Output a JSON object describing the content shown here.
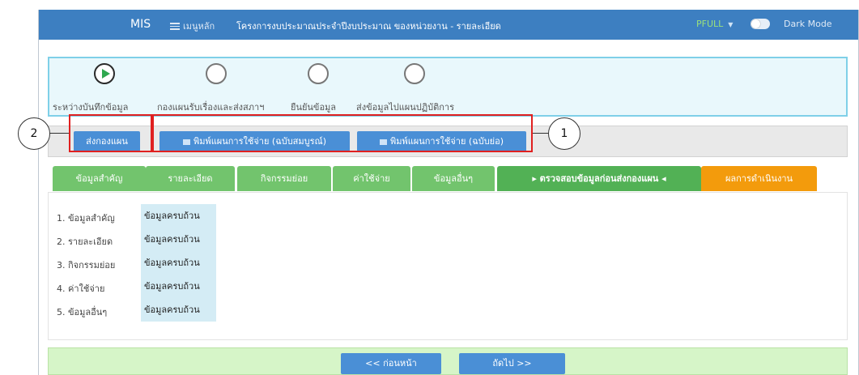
{
  "header": {
    "brand": "MIS",
    "menu_label": "เมนูหลัก",
    "breadcrumb": "โครงการงบประมาณประจำปีงบประมาณ ของหน่วยงาน - รายละเอียด",
    "user": "PFULL",
    "dark_mode_label": "Dark Mode"
  },
  "steps": [
    {
      "label": "ระหว่างบันทึกข้อมูล",
      "state": "active"
    },
    {
      "label": "กองแผนรับเรื่องและส่งสภาฯ",
      "state": "pending"
    },
    {
      "label": "ยืนยันข้อมูล",
      "state": "pending"
    },
    {
      "label": "ส่งข้อมูลไปแผนปฏิบัติการ",
      "state": "pending"
    }
  ],
  "actions": {
    "send_label": "ส่งกองแผน",
    "print_full_label": "พิมพ์แผนการใช้จ่าย (ฉบับสมบูรณ์)",
    "print_short_label": "พิมพ์แผนการใช้จ่าย (ฉบับย่อ)"
  },
  "callouts": {
    "one": "1",
    "two": "2"
  },
  "tabs": [
    {
      "label": "ข้อมูลสำคัญ"
    },
    {
      "label": "รายละเอียด"
    },
    {
      "label": "กิจกรรมย่อย"
    },
    {
      "label": "ค่าใช้จ่าย"
    },
    {
      "label": "ข้อมูลอื่นๆ"
    },
    {
      "label": "▸ ตรวจสอบข้อมูลก่อนส่งกองแผน ◂"
    },
    {
      "label": "ผลการดำเนินงาน"
    }
  ],
  "checklist": [
    {
      "label": "1.  ข้อมูลสำคัญ",
      "status": "ข้อมูลครบถ้วน"
    },
    {
      "label": "2.  รายละเอียด",
      "status": "ข้อมูลครบถ้วน"
    },
    {
      "label": "3.  กิจกรรมย่อย",
      "status": "ข้อมูลครบถ้วน"
    },
    {
      "label": "4.  ค่าใช้จ่าย",
      "status": "ข้อมูลครบถ้วน"
    },
    {
      "label": "5.  ข้อมูลอื่นๆ",
      "status": "ข้อมูลครบถ้วน"
    }
  ],
  "navigation": {
    "prev_label": "<< ก่อนหน้า",
    "next_label": "ถัดไป >>"
  },
  "colors": {
    "topbar": "#3d7fc1",
    "tab_green": "#72c46d",
    "tab_active": "#52b155",
    "tab_orange": "#f39b0c",
    "button_blue": "#4a8fd6",
    "highlight_red": "#e02020"
  }
}
